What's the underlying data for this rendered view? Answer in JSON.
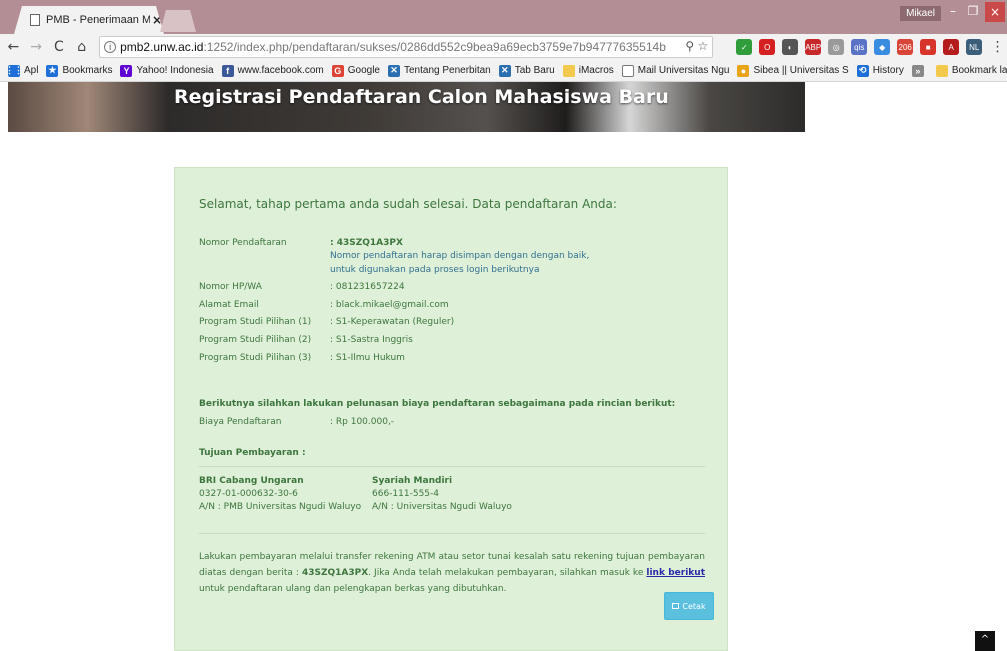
{
  "browser": {
    "tab_title": "PMB - Penerimaan Maha",
    "tab_close": "×",
    "profile": "Mikael",
    "win_min": "–",
    "win_max": "❐",
    "win_close": "×",
    "url_host": "pmb2.unw.ac.id",
    "url_path": ":1252/index.php/pendaftaran/sukses/0286dd552c9bea9a69ecb3759e7b94777635514b",
    "info_icon": "i",
    "zoom_icon": "⚲",
    "star_icon": "☆",
    "back": "←",
    "forward": "→",
    "reload": "C",
    "home": "⌂",
    "menu": "⋮",
    "extensions": [
      {
        "name": "check-ext-icon",
        "label": "✓",
        "color": "#2e9d3a"
      },
      {
        "name": "opera-ext-icon",
        "label": "O",
        "color": "#d42020"
      },
      {
        "name": "moon-ext-icon",
        "label": "◐",
        "color": "#555555"
      },
      {
        "name": "adblock-ext-icon",
        "label": "ABP",
        "color": "#c9282b"
      },
      {
        "name": "circle-ext-icon",
        "label": "◎",
        "color": "#9a9a9a"
      },
      {
        "name": "qis-ext-icon",
        "label": "qis",
        "color": "#5a73c7"
      },
      {
        "name": "diamond-ext-icon",
        "label": "◆",
        "color": "#3a8ce0"
      },
      {
        "name": "gmail-ext-icon",
        "label": "206",
        "color": "#d94638"
      },
      {
        "name": "red-ext-icon",
        "label": "■",
        "color": "#d9342b"
      },
      {
        "name": "pdf-ext-icon",
        "label": "A",
        "color": "#b51c1c"
      },
      {
        "name": "nl-ext-icon",
        "label": "NL",
        "color": "#3b5e7a"
      }
    ],
    "bookmarks": [
      {
        "name": "bookmark-apps",
        "icon": "⋮⋮",
        "icon_color": "#1f6fd9",
        "label": "Apl"
      },
      {
        "name": "bookmark-bookmarks",
        "icon": "★",
        "icon_color": "#1f6fd9",
        "label": "Bookmarks"
      },
      {
        "name": "bookmark-yahoo",
        "icon": "Y",
        "icon_color": "#5f01d1",
        "label": "Yahoo! Indonesia"
      },
      {
        "name": "bookmark-facebook",
        "icon": "f",
        "icon_color": "#3b5998",
        "label": "www.facebook.com"
      },
      {
        "name": "bookmark-google",
        "icon": "G",
        "icon_color": "#db4437",
        "label": "Google"
      },
      {
        "name": "bookmark-tentang",
        "icon": "✕",
        "icon_color": "#2a6fb0",
        "label": "Tentang Penerbitan"
      },
      {
        "name": "bookmark-tabbaru",
        "icon": "✕",
        "icon_color": "#2a6fb0",
        "label": "Tab Baru"
      },
      {
        "name": "bookmark-imacros",
        "icon": " ",
        "icon_color": "#f2c94c",
        "label": "iMacros"
      },
      {
        "name": "bookmark-mail",
        "icon": " ",
        "icon_color": "#ffffff",
        "label": "Mail Universitas Ngu"
      },
      {
        "name": "bookmark-sibea",
        "icon": "●",
        "icon_color": "#e8a317",
        "label": "Sibea || Universitas S"
      },
      {
        "name": "bookmark-history",
        "icon": "⟲",
        "icon_color": "#1f6fd9",
        "label": "History"
      },
      {
        "name": "bookmark-more",
        "icon": "»",
        "icon_color": "#888888",
        "label": ""
      },
      {
        "name": "bookmark-other",
        "icon": " ",
        "icon_color": "#f2c94c",
        "label": "Bookmark lain"
      }
    ]
  },
  "page": {
    "banner_title": "Registrasi Pendaftaran Calon Mahasiswa Baru",
    "intro": "Selamat, tahap pertama anda sudah selesai. Data pendaftaran Anda:",
    "fields": [
      {
        "label": "Nomor Pendaftaran",
        "value": ": 43SZQ1A3PX"
      },
      {
        "label": "Nomor HP/WA",
        "value": ": 081231657224"
      },
      {
        "label": "Alamat Email",
        "value": ": black.mikael@gmail.com"
      },
      {
        "label": "Program Studi Pilihan (1)",
        "value": ": S1-Keperawatan (Reguler)"
      },
      {
        "label": "Program Studi Pilihan (2)",
        "value": ": S1-Sastra Inggris"
      },
      {
        "label": "Program Studi Pilihan (3)",
        "value": ": S1-Ilmu Hukum"
      }
    ],
    "note_line1": "Nomor pendaftaran harap disimpan dengan dengan baik,",
    "note_line2": "untuk digunakan pada proses login berikutnya",
    "payment_heading": "Berikutnya silahkan lakukan pelunasan biaya pendaftaran sebagaimana pada rincian berikut:",
    "fee_label": "Biaya Pendaftaran",
    "fee_value": ": Rp 100.000,-",
    "destination_heading": "Tujuan Pembayaran :",
    "banks": [
      {
        "name": "BRI Cabang Ungaran",
        "account": "0327-01-000632-30-6",
        "holder": "A/N : PMB Universitas Ngudi Waluyo"
      },
      {
        "name": "Syariah Mandiri",
        "account": "666-111-555-4",
        "holder": "A/N : Universitas Ngudi Waluyo"
      }
    ],
    "para_part1": "Lakukan pembayaran melalui transfer rekening ATM atau setor tunai kesalah satu rekening tujuan pembayaran diatas dengan berita : ",
    "para_code": "43SZQ1A3PX",
    "para_part2": ". Jika Anda telah melakukan pembayaran, silahkan masuk ke ",
    "para_link": "link berikut",
    "para_part3": " untuk pendaftaran ulang dan pelengkapan berkas yang dibutuhkan.",
    "print_label": "Cetak",
    "scroll_top": "^"
  }
}
